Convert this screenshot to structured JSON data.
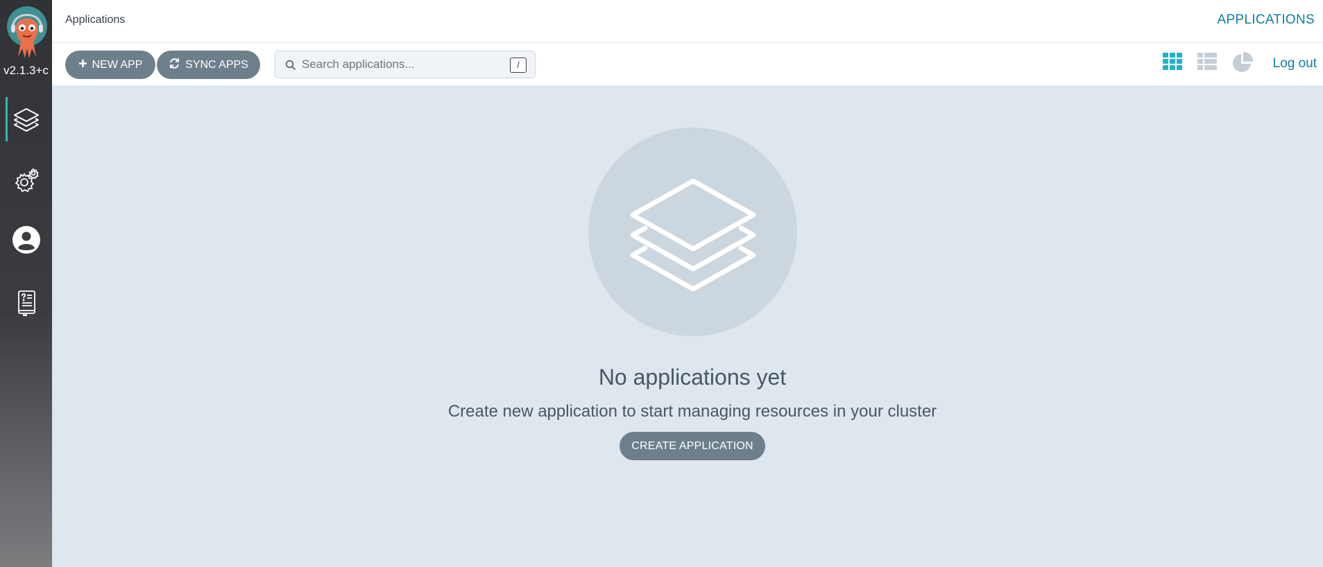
{
  "sidebar": {
    "version": "v2.1.3+c",
    "items": [
      {
        "name": "applications",
        "icon": "layers-icon",
        "active": true
      },
      {
        "name": "settings",
        "icon": "gears-icon",
        "active": false
      },
      {
        "name": "user-info",
        "icon": "user-circle-icon",
        "active": false
      },
      {
        "name": "documentation",
        "icon": "docs-book-icon",
        "active": false
      }
    ]
  },
  "header": {
    "breadcrumb": "Applications",
    "title": "APPLICATIONS"
  },
  "toolbar": {
    "new_app_label": "NEW APP",
    "sync_apps_label": "SYNC APPS",
    "search_placeholder": "Search applications...",
    "search_shortcut": "/",
    "views": [
      "tiles-view-icon",
      "list-view-icon",
      "summary-pie-icon"
    ],
    "active_view": "tiles",
    "logout_label": "Log out"
  },
  "empty_state": {
    "title": "No applications yet",
    "subtitle": "Create new application to start managing resources in your cluster",
    "button_label": "CREATE APPLICATION"
  },
  "colors": {
    "accent": "#0c7fa0",
    "active_icon": "#1fb3c6",
    "button": "#6d7f8b",
    "background": "#dee6ee"
  }
}
